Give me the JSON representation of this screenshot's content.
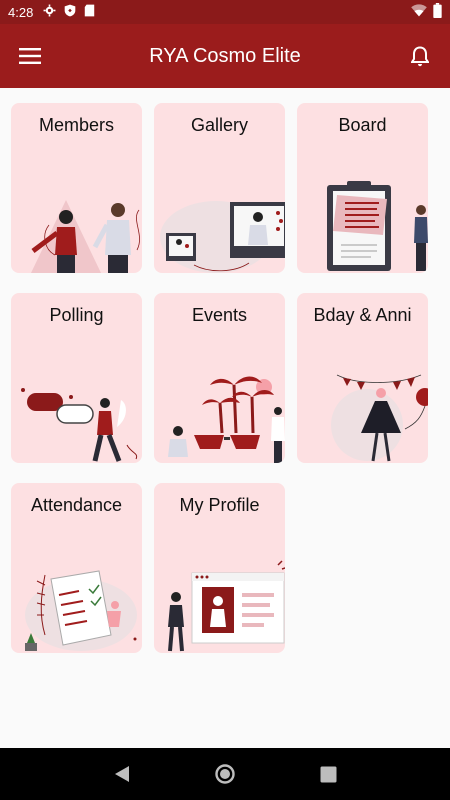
{
  "status": {
    "time": "4:28",
    "icons": [
      "gear-icon",
      "shield-icon",
      "sd-card-icon"
    ],
    "right_icons": [
      "wifi-icon",
      "battery-icon"
    ]
  },
  "app_bar": {
    "title": "RYA Cosmo Elite",
    "menu_icon": "hamburger-menu-icon",
    "notification_icon": "bell-icon"
  },
  "colors": {
    "primary": "#9b1c1c",
    "status_bar": "#8b1a1a",
    "tile_bg": "#fde0e2",
    "accent": "#8b1a1a"
  },
  "tiles": [
    {
      "label": "Members"
    },
    {
      "label": "Gallery"
    },
    {
      "label": "Board"
    },
    {
      "label": "Polling"
    },
    {
      "label": "Events"
    },
    {
      "label": "Bday & Anni"
    },
    {
      "label": "Attendance"
    },
    {
      "label": "My Profile"
    }
  ],
  "nav": {
    "back_icon": "back-triangle-icon",
    "home_icon": "home-circle-icon",
    "recents_icon": "recents-square-icon"
  }
}
